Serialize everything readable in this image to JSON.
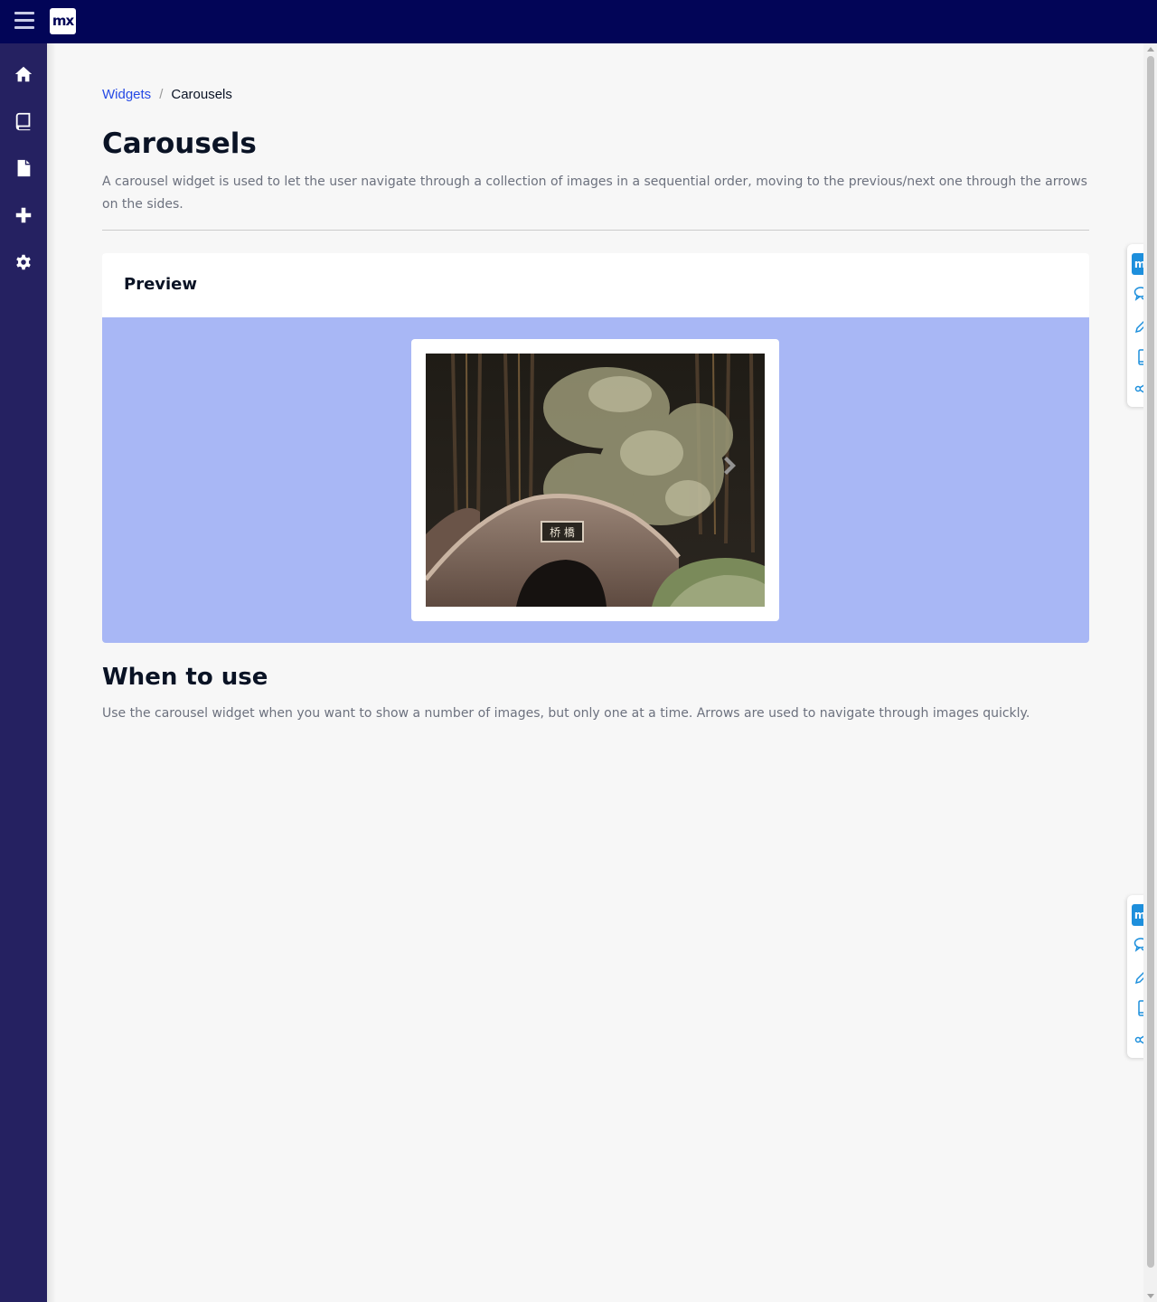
{
  "header": {
    "logo_text": "mx"
  },
  "sidebar": {
    "items": [
      {
        "icon": "home-icon"
      },
      {
        "icon": "book-icon"
      },
      {
        "icon": "file-icon"
      },
      {
        "icon": "plus-icon"
      },
      {
        "icon": "gear-icon"
      }
    ]
  },
  "breadcrumb": {
    "parent": "Widgets",
    "separator": "/",
    "current": "Carousels"
  },
  "page": {
    "title": "Carousels",
    "description": "A carousel widget is used to let the user navigate through a collection of images in a sequential order, moving to the previous/next one through the arrows on the sides."
  },
  "preview": {
    "title": "Preview",
    "image_alt": "stone arch bridge with bamboo at night"
  },
  "when_to_use": {
    "title": "When to use",
    "text": "Use the carousel widget when you want to show a number of images, but only one at a time. Arrows are used to navigate through images quickly."
  },
  "tool_panels": [
    {
      "logo_text": "mx",
      "tools": [
        "feedback-icon",
        "edit-icon",
        "mobile-icon",
        "share-icon"
      ]
    },
    {
      "logo_text": "mx",
      "tools": [
        "feedback-icon",
        "edit-icon",
        "mobile-icon",
        "share-icon"
      ]
    }
  ],
  "colors": {
    "topbar": "#020557",
    "sidebar": "#252161",
    "link": "#264ae5",
    "preview_bg": "#a8b7f5",
    "tool_accent": "#1d8fdc"
  }
}
